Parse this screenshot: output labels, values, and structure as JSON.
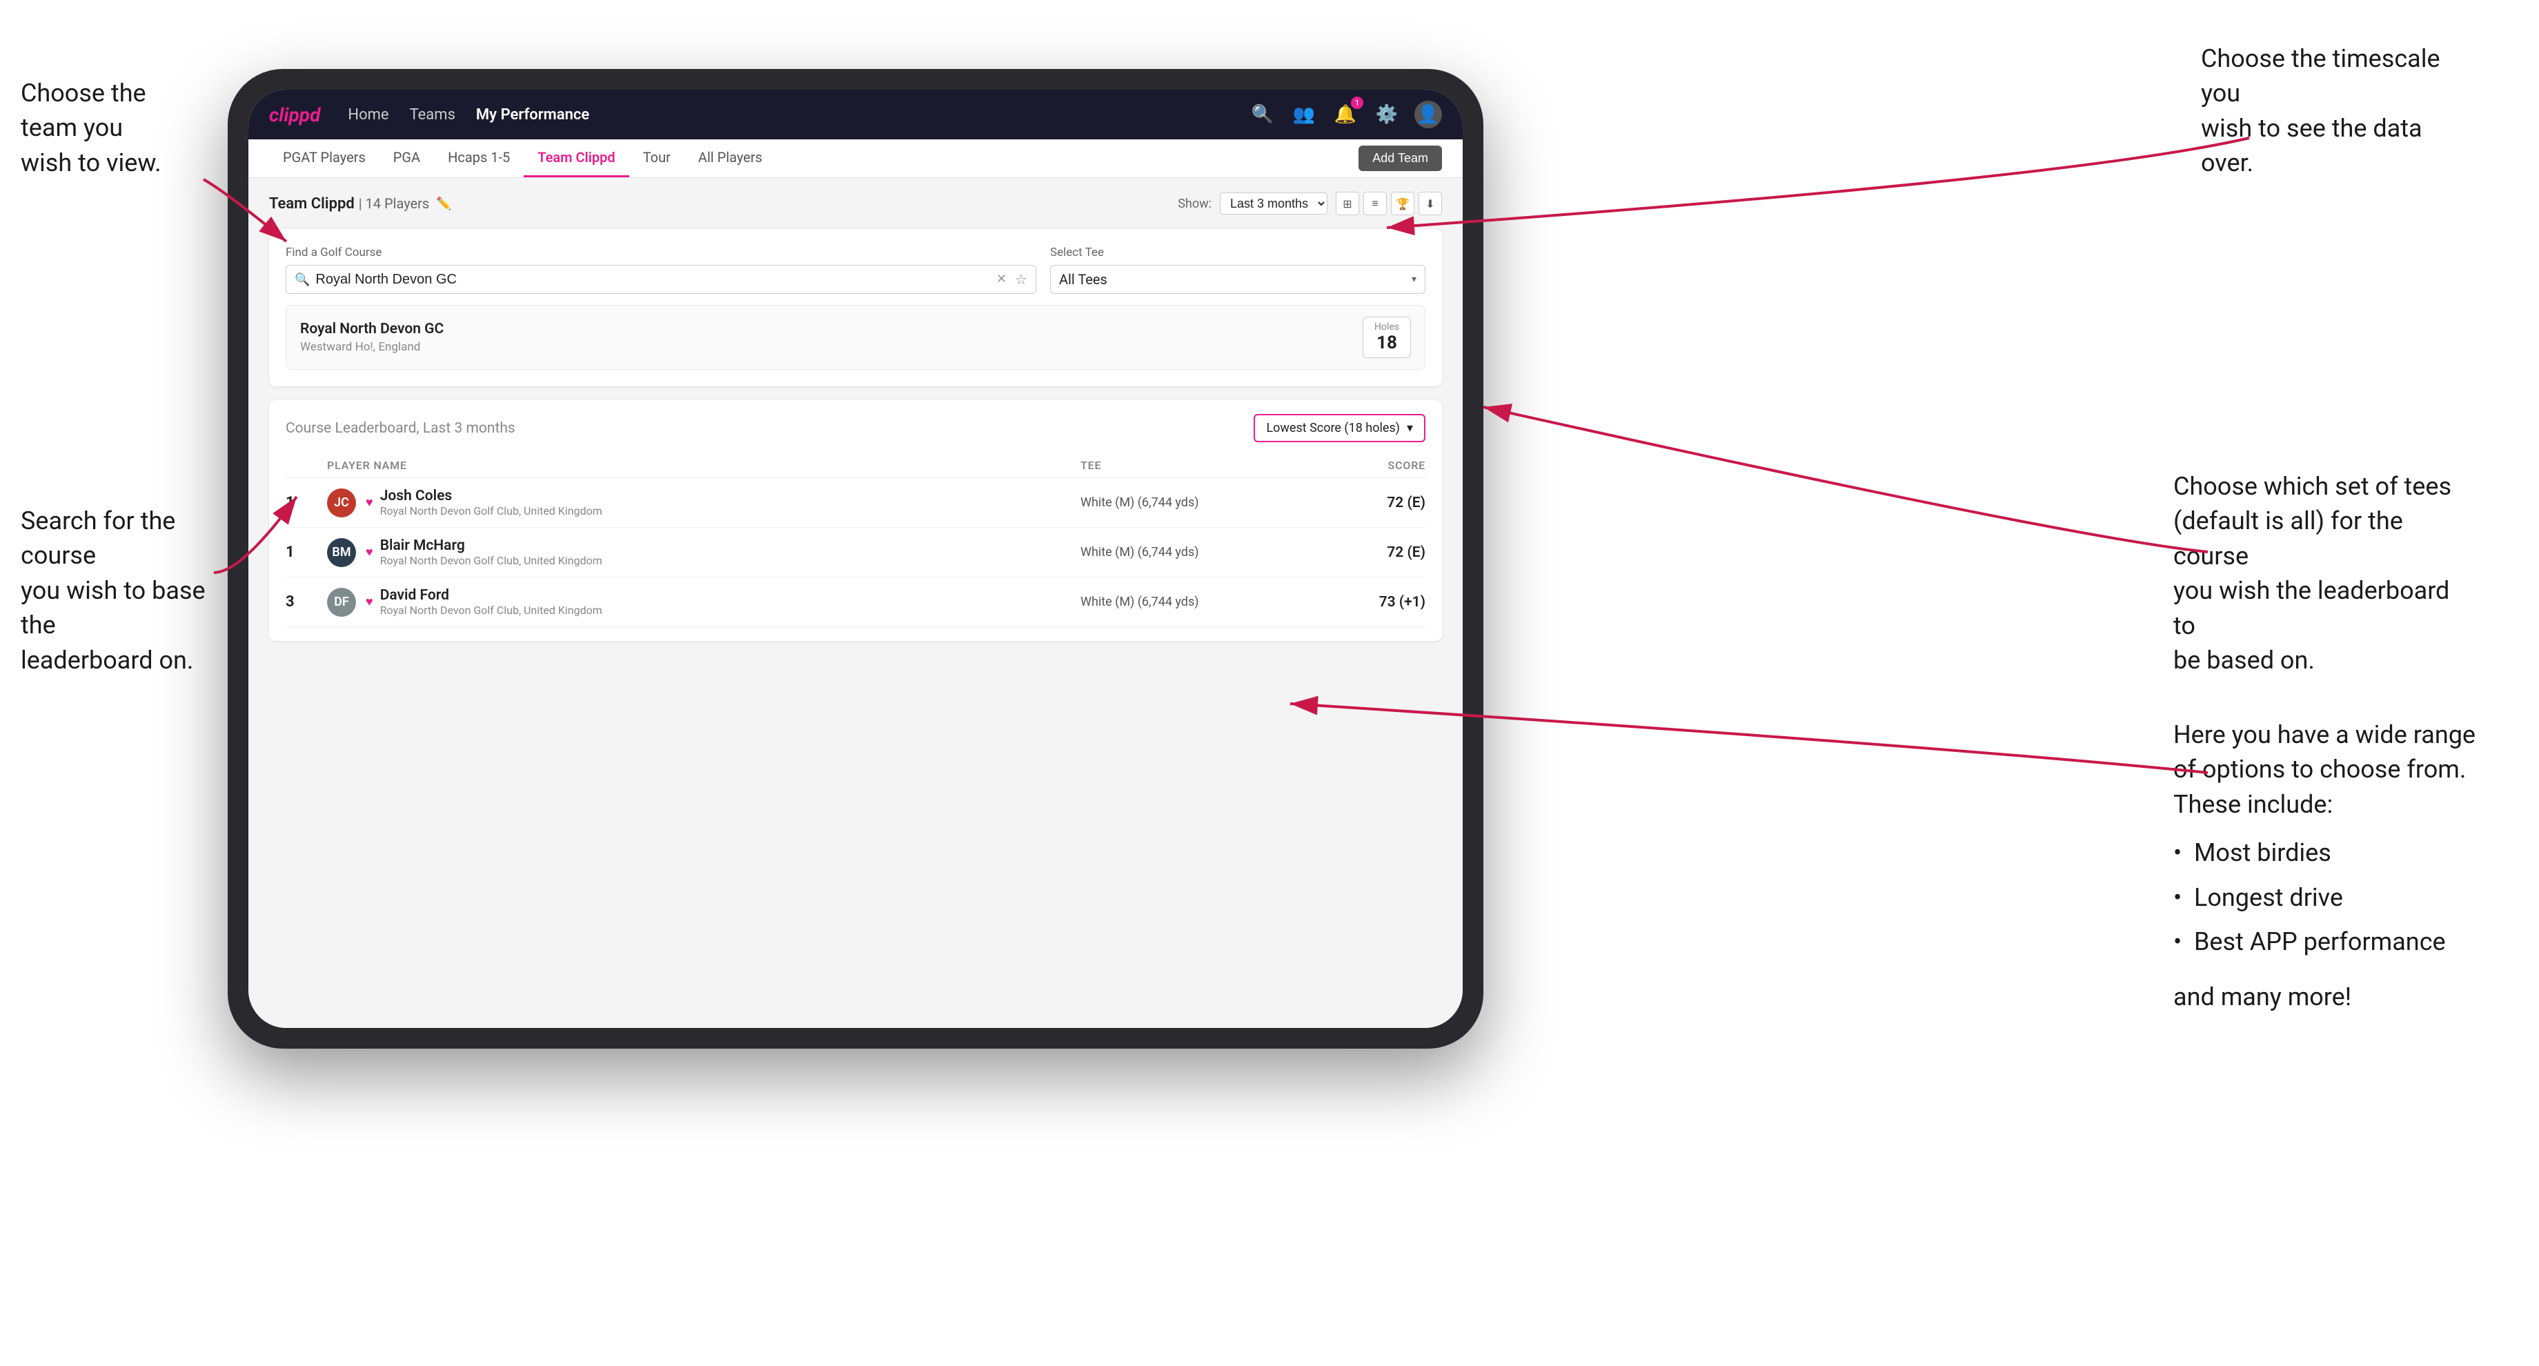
{
  "annotations": {
    "top_left": {
      "title": "Choose the team you\nwish to view."
    },
    "top_right": {
      "title": "Choose the timescale you\nwish to see the data over."
    },
    "right_mid": {
      "title": "Choose which set of tees\n(default is all) for the course\nyou wish the leaderboard to\nbe based on."
    },
    "left_mid": {
      "title": "Search for the course\nyou wish to base the\nleaderboard on."
    },
    "right_score": {
      "title": "Here you have a wide range\nof options to choose from.\nThese include:",
      "bullets": [
        "Most birdies",
        "Longest drive",
        "Best APP performance"
      ],
      "and_more": "and many more!"
    }
  },
  "nav": {
    "logo": "clippd",
    "links": [
      "Home",
      "Teams",
      "My Performance"
    ],
    "active_link": "My Performance",
    "icons": [
      "search",
      "people",
      "bell",
      "settings",
      "user"
    ]
  },
  "sub_nav": {
    "items": [
      "PGAT Players",
      "PGA",
      "Hcaps 1-5",
      "Team Clippd",
      "Tour",
      "All Players"
    ],
    "active_item": "Team Clippd",
    "add_button": "Add Team"
  },
  "team_header": {
    "title": "Team Clippd",
    "count": "14 Players",
    "show_label": "Show:",
    "show_value": "Last 3 months",
    "view_icons": [
      "grid",
      "list",
      "trophy",
      "download"
    ]
  },
  "search": {
    "find_label": "Find a Golf Course",
    "find_placeholder": "Royal North Devon GC",
    "tee_label": "Select Tee",
    "tee_value": "All Tees"
  },
  "course_result": {
    "name": "Royal North Devon GC",
    "location": "Westward Ho!, England",
    "holes_label": "Holes",
    "holes": "18"
  },
  "leaderboard": {
    "title": "Course Leaderboard,",
    "subtitle": "Last 3 months",
    "score_type": "Lowest Score (18 holes)",
    "col_player": "PLAYER NAME",
    "col_tee": "TEE",
    "col_score": "SCORE",
    "players": [
      {
        "rank": "1",
        "name": "Josh Coles",
        "club": "Royal North Devon Golf Club, United Kingdom",
        "tee": "White (M) (6,744 yds)",
        "score": "72 (E)",
        "avatar_bg": "#c0392b",
        "avatar_text": "JC"
      },
      {
        "rank": "1",
        "name": "Blair McHarg",
        "club": "Royal North Devon Golf Club, United Kingdom",
        "tee": "White (M) (6,744 yds)",
        "score": "72 (E)",
        "avatar_bg": "#2c3e50",
        "avatar_text": "BM"
      },
      {
        "rank": "3",
        "name": "David Ford",
        "club": "Royal North Devon Golf Club, United Kingdom",
        "tee": "White (M) (6,744 yds)",
        "score": "73 (+1)",
        "avatar_bg": "#7f8c8d",
        "avatar_text": "DF"
      }
    ]
  }
}
